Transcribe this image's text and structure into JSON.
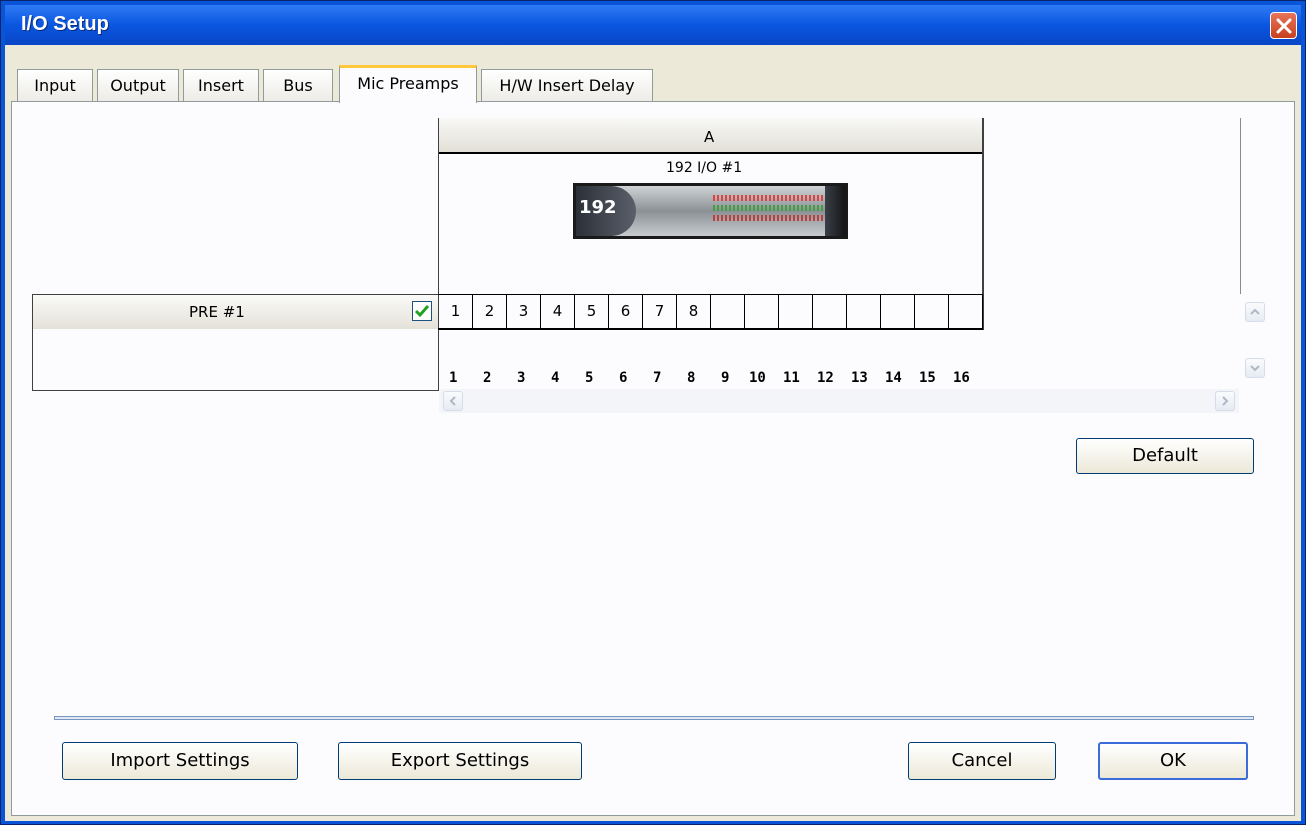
{
  "window": {
    "title": "I/O Setup"
  },
  "tabs": [
    {
      "label": "Input",
      "active": false
    },
    {
      "label": "Output",
      "active": false
    },
    {
      "label": "Insert",
      "active": false
    },
    {
      "label": "Bus",
      "active": false
    },
    {
      "label": "Mic Preamps",
      "active": true
    },
    {
      "label": "H/W Insert Delay",
      "active": false
    }
  ],
  "matrix": {
    "column_header": "A",
    "device_name": "192 I/O #1",
    "device_badge": "192",
    "channel_numbers": [
      "1",
      "2",
      "3",
      "4",
      "5",
      "6",
      "7",
      "8",
      "9",
      "10",
      "11",
      "12",
      "13",
      "14",
      "15",
      "16"
    ],
    "row": {
      "label": "PRE #1",
      "checked": true,
      "assignments": [
        "1",
        "2",
        "3",
        "4",
        "5",
        "6",
        "7",
        "8",
        "",
        "",
        "",
        "",
        "",
        "",
        "",
        ""
      ]
    }
  },
  "buttons": {
    "default": "Default",
    "import": "Import Settings",
    "export": "Export Settings",
    "cancel": "Cancel",
    "ok": "OK"
  },
  "colors": {
    "titlebar": "#0a56e0",
    "active_tab_accent": "#ffc83c",
    "check": "#21a121",
    "panel": "#fcfcfe"
  }
}
